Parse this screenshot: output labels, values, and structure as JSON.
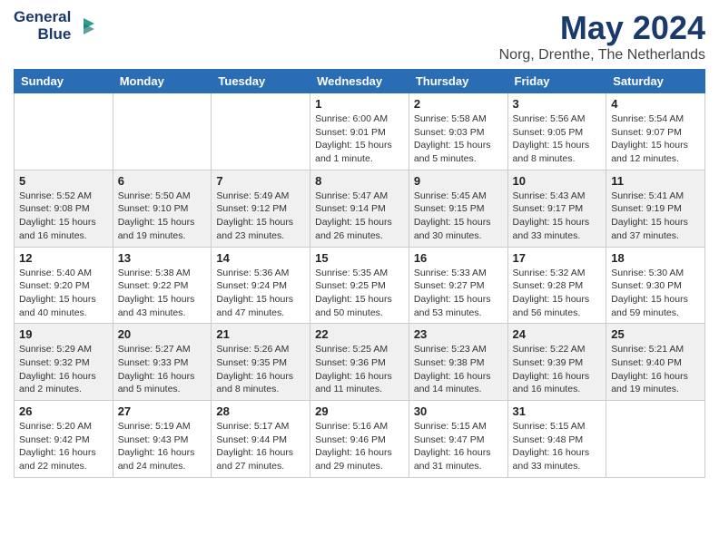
{
  "header": {
    "logo_line1": "General",
    "logo_line2": "Blue",
    "month_title": "May 2024",
    "location": "Norg, Drenthe, The Netherlands"
  },
  "weekdays": [
    "Sunday",
    "Monday",
    "Tuesday",
    "Wednesday",
    "Thursday",
    "Friday",
    "Saturday"
  ],
  "weeks": [
    [
      {
        "day": "",
        "info": ""
      },
      {
        "day": "",
        "info": ""
      },
      {
        "day": "",
        "info": ""
      },
      {
        "day": "1",
        "info": "Sunrise: 6:00 AM\nSunset: 9:01 PM\nDaylight: 15 hours\nand 1 minute."
      },
      {
        "day": "2",
        "info": "Sunrise: 5:58 AM\nSunset: 9:03 PM\nDaylight: 15 hours\nand 5 minutes."
      },
      {
        "day": "3",
        "info": "Sunrise: 5:56 AM\nSunset: 9:05 PM\nDaylight: 15 hours\nand 8 minutes."
      },
      {
        "day": "4",
        "info": "Sunrise: 5:54 AM\nSunset: 9:07 PM\nDaylight: 15 hours\nand 12 minutes."
      }
    ],
    [
      {
        "day": "5",
        "info": "Sunrise: 5:52 AM\nSunset: 9:08 PM\nDaylight: 15 hours\nand 16 minutes."
      },
      {
        "day": "6",
        "info": "Sunrise: 5:50 AM\nSunset: 9:10 PM\nDaylight: 15 hours\nand 19 minutes."
      },
      {
        "day": "7",
        "info": "Sunrise: 5:49 AM\nSunset: 9:12 PM\nDaylight: 15 hours\nand 23 minutes."
      },
      {
        "day": "8",
        "info": "Sunrise: 5:47 AM\nSunset: 9:14 PM\nDaylight: 15 hours\nand 26 minutes."
      },
      {
        "day": "9",
        "info": "Sunrise: 5:45 AM\nSunset: 9:15 PM\nDaylight: 15 hours\nand 30 minutes."
      },
      {
        "day": "10",
        "info": "Sunrise: 5:43 AM\nSunset: 9:17 PM\nDaylight: 15 hours\nand 33 minutes."
      },
      {
        "day": "11",
        "info": "Sunrise: 5:41 AM\nSunset: 9:19 PM\nDaylight: 15 hours\nand 37 minutes."
      }
    ],
    [
      {
        "day": "12",
        "info": "Sunrise: 5:40 AM\nSunset: 9:20 PM\nDaylight: 15 hours\nand 40 minutes."
      },
      {
        "day": "13",
        "info": "Sunrise: 5:38 AM\nSunset: 9:22 PM\nDaylight: 15 hours\nand 43 minutes."
      },
      {
        "day": "14",
        "info": "Sunrise: 5:36 AM\nSunset: 9:24 PM\nDaylight: 15 hours\nand 47 minutes."
      },
      {
        "day": "15",
        "info": "Sunrise: 5:35 AM\nSunset: 9:25 PM\nDaylight: 15 hours\nand 50 minutes."
      },
      {
        "day": "16",
        "info": "Sunrise: 5:33 AM\nSunset: 9:27 PM\nDaylight: 15 hours\nand 53 minutes."
      },
      {
        "day": "17",
        "info": "Sunrise: 5:32 AM\nSunset: 9:28 PM\nDaylight: 15 hours\nand 56 minutes."
      },
      {
        "day": "18",
        "info": "Sunrise: 5:30 AM\nSunset: 9:30 PM\nDaylight: 15 hours\nand 59 minutes."
      }
    ],
    [
      {
        "day": "19",
        "info": "Sunrise: 5:29 AM\nSunset: 9:32 PM\nDaylight: 16 hours\nand 2 minutes."
      },
      {
        "day": "20",
        "info": "Sunrise: 5:27 AM\nSunset: 9:33 PM\nDaylight: 16 hours\nand 5 minutes."
      },
      {
        "day": "21",
        "info": "Sunrise: 5:26 AM\nSunset: 9:35 PM\nDaylight: 16 hours\nand 8 minutes."
      },
      {
        "day": "22",
        "info": "Sunrise: 5:25 AM\nSunset: 9:36 PM\nDaylight: 16 hours\nand 11 minutes."
      },
      {
        "day": "23",
        "info": "Sunrise: 5:23 AM\nSunset: 9:38 PM\nDaylight: 16 hours\nand 14 minutes."
      },
      {
        "day": "24",
        "info": "Sunrise: 5:22 AM\nSunset: 9:39 PM\nDaylight: 16 hours\nand 16 minutes."
      },
      {
        "day": "25",
        "info": "Sunrise: 5:21 AM\nSunset: 9:40 PM\nDaylight: 16 hours\nand 19 minutes."
      }
    ],
    [
      {
        "day": "26",
        "info": "Sunrise: 5:20 AM\nSunset: 9:42 PM\nDaylight: 16 hours\nand 22 minutes."
      },
      {
        "day": "27",
        "info": "Sunrise: 5:19 AM\nSunset: 9:43 PM\nDaylight: 16 hours\nand 24 minutes."
      },
      {
        "day": "28",
        "info": "Sunrise: 5:17 AM\nSunset: 9:44 PM\nDaylight: 16 hours\nand 27 minutes."
      },
      {
        "day": "29",
        "info": "Sunrise: 5:16 AM\nSunset: 9:46 PM\nDaylight: 16 hours\nand 29 minutes."
      },
      {
        "day": "30",
        "info": "Sunrise: 5:15 AM\nSunset: 9:47 PM\nDaylight: 16 hours\nand 31 minutes."
      },
      {
        "day": "31",
        "info": "Sunrise: 5:15 AM\nSunset: 9:48 PM\nDaylight: 16 hours\nand 33 minutes."
      },
      {
        "day": "",
        "info": ""
      }
    ]
  ]
}
